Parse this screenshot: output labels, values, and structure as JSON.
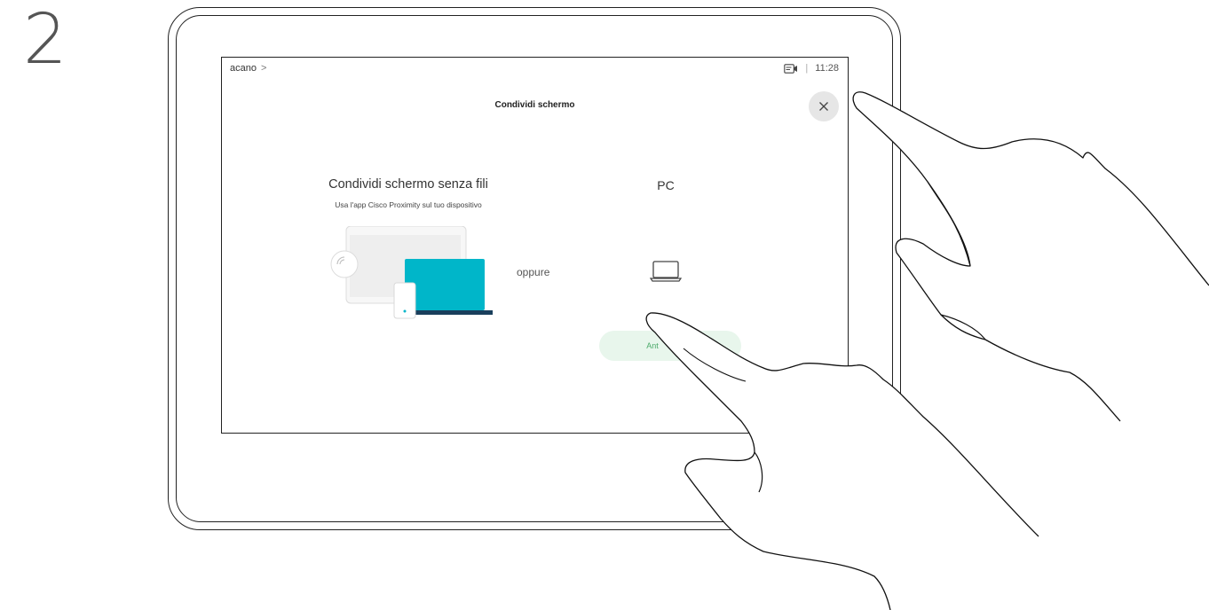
{
  "step": {
    "number": "2"
  },
  "device": {
    "topbar": {
      "site_name": "acano",
      "chevron": ">",
      "separator": "|",
      "time": "11:28",
      "camera_icon": "camera-icon"
    },
    "dialog": {
      "title": "Condividi schermo",
      "close_icon": "close-icon",
      "wireless": {
        "heading": "Condividi schermo senza fili",
        "subtitle": "Usa l'app Cisco Proximity sul tuo dispositivo"
      },
      "separator_text": "oppure",
      "pc": {
        "heading": "PC",
        "icon": "laptop-icon"
      },
      "share_button_label": "Ant"
    }
  },
  "colors": {
    "accent_teal": "#00b6c9",
    "dark_navy": "#1a3f5c",
    "button_bg": "#e8f6ec",
    "button_text": "#4caa6a"
  }
}
